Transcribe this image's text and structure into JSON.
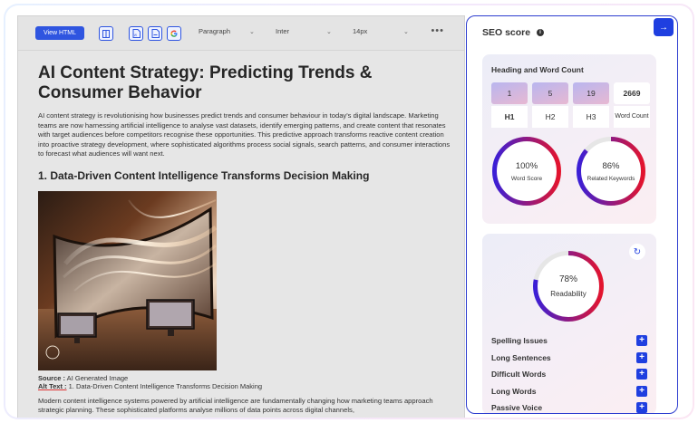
{
  "toolbar": {
    "view_html_label": "View HTML",
    "paragraph_select": "Paragraph",
    "font_select": "Inter",
    "size_select": "14px",
    "more_label": "•••"
  },
  "article": {
    "title": "AI Content Strategy: Predicting Trends & Consumer Behavior",
    "intro": "AI content strategy is revolutionising how businesses predict trends and consumer behaviour in today's digital landscape. Marketing teams are now harnessing artificial intelligence to analyse vast datasets, identify emerging patterns, and create content that resonates with target audiences before competitors recognise these opportunities. This predictive approach transforms reactive content creation into proactive strategy development, where sophisticated algorithms process social signals, search patterns, and consumer interactions to forecast what audiences will want next.",
    "section_heading": "1. Data-Driven Content Intelligence Transforms Decision Making",
    "source_label": "Source :",
    "source_value": " AI Generated Image",
    "alt_label": "Alt Text :",
    "alt_value": " 1. Data-Driven Content Intelligence Transforms Decision Making",
    "body_para": "Modern content intelligence systems powered by artificial intelligence are fundamentally changing how marketing teams approach strategic planning. These sophisticated platforms analyse millions of data points across digital channels,"
  },
  "seo": {
    "title": "SEO score",
    "info_icon": "i",
    "collapse_icon": "→",
    "heading_card": {
      "title": "Heading and Word Count",
      "counts": [
        {
          "value": "1",
          "label": "H1"
        },
        {
          "value": "5",
          "label": "H2"
        },
        {
          "value": "19",
          "label": "H3"
        },
        {
          "value": "2669",
          "label": "Word Count"
        }
      ],
      "word_score": {
        "value": "100%",
        "label": "Word Score",
        "fraction": 1.0
      },
      "related_keywords": {
        "value": "86%",
        "label": "Related Keywords",
        "fraction": 0.86
      }
    },
    "readability_card": {
      "refresh_icon": "↻",
      "readability": {
        "value": "78%",
        "label": "Readability",
        "fraction": 0.78
      },
      "issues": [
        {
          "label": "Spelling Issues"
        },
        {
          "label": "Long Sentences"
        },
        {
          "label": "Difficult Words"
        },
        {
          "label": "Long Words"
        },
        {
          "label": "Passive Voice"
        }
      ],
      "plus_icon": "+"
    }
  },
  "colors": {
    "accent": "#1f3fe0",
    "gauge_start": "#3b1fd6",
    "gauge_end": "#e3142e",
    "gauge_track": "#e6e6e6"
  }
}
